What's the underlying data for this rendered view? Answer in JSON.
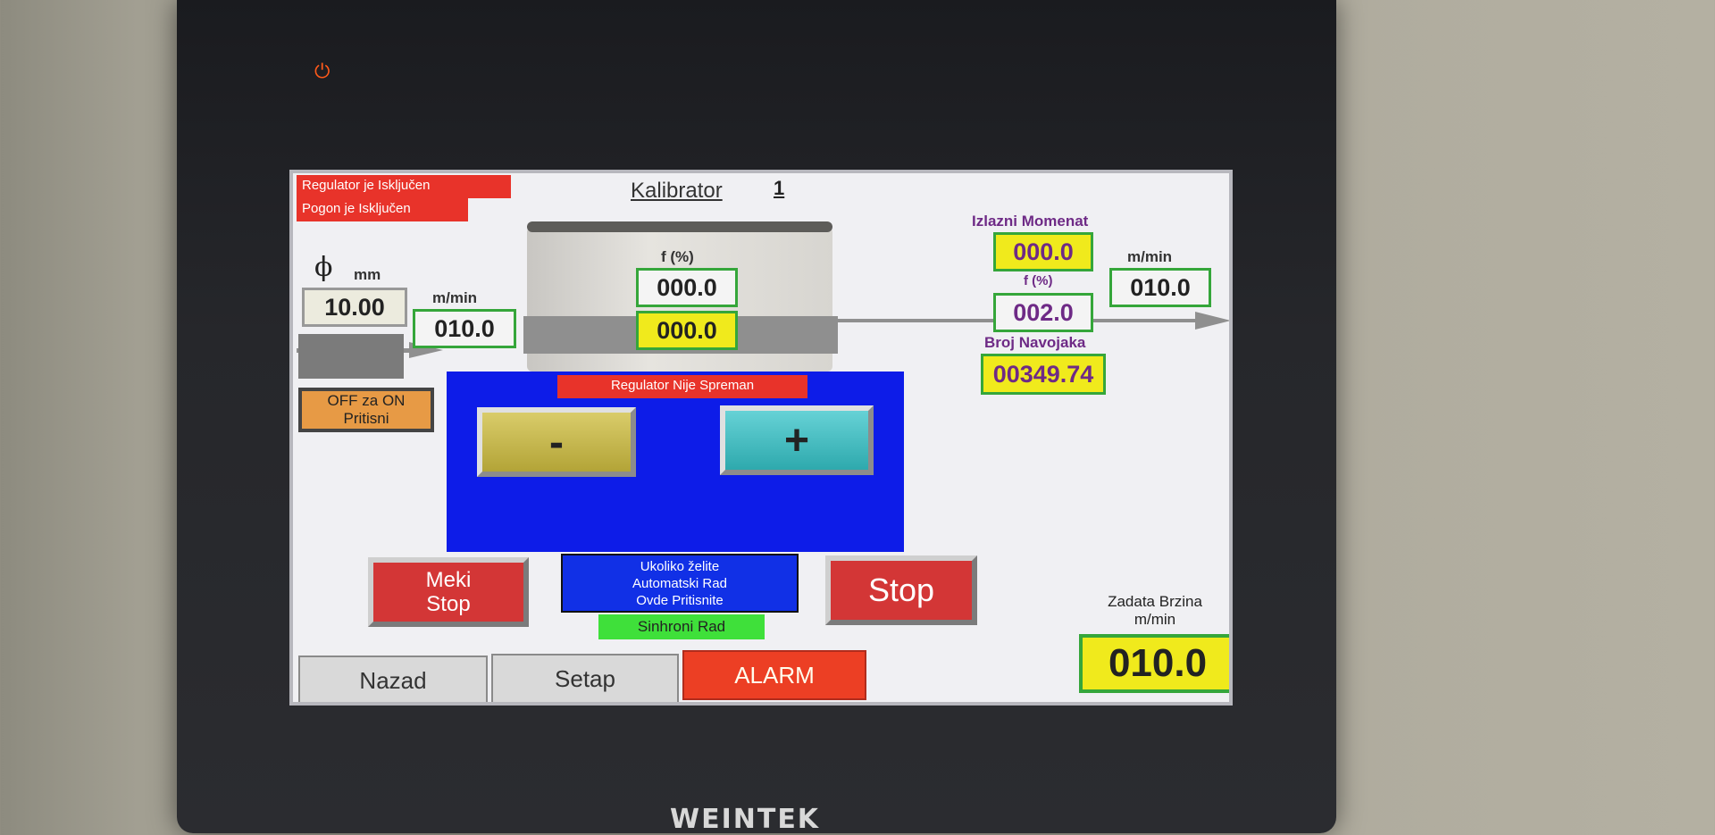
{
  "device": {
    "brand": "WEINTEK",
    "power_icon": "⏻"
  },
  "status": {
    "regulator": "Regulator je Isključen",
    "drive": "Pogon je Isključen"
  },
  "header": {
    "title": "Kalibrator",
    "number": "1"
  },
  "input_side": {
    "diameter_symbol": "ϕ",
    "diameter_unit": "mm",
    "diameter_value": "10.00",
    "speed_unit": "m/min",
    "speed_value": "010.0",
    "toggle_label_line1": "OFF za ON",
    "toggle_label_line2": "Pritisni"
  },
  "center": {
    "f_label": "f (%)",
    "f_value": "000.0",
    "f_value_yellow": "000.0",
    "regulator_status": "Regulator Nije Spreman",
    "minus_label": "-",
    "plus_label": "+"
  },
  "output_side": {
    "torque_label": "Izlazni Momenat",
    "torque_value": "000.0",
    "f_label": "f (%)",
    "f_value": "002.0",
    "speed_unit": "m/min",
    "speed_value": "010.0",
    "turns_label": "Broj Navojaka",
    "turns_value": "00349.74"
  },
  "controls": {
    "soft_stop_line1": "Meki",
    "soft_stop_line2": "Stop",
    "auto_line1": "Ukoliko želite",
    "auto_line2": "Automatski Rad",
    "auto_line3": "Ovde Pritisnite",
    "sync_mode": "Sinhroni Rad",
    "stop_label": "Stop"
  },
  "setpoint": {
    "label_line1": "Zadata Brzina",
    "label_line2": "m/min",
    "value": "010.0"
  },
  "tabs": {
    "back": "Nazad",
    "setup": "Setap",
    "alarm": "ALARM"
  },
  "colors": {
    "panel_blue": "#0d1ce8",
    "value_border_green": "#35a63a",
    "alarm_red": "#ec3f24",
    "value_yellow": "#f0ea1c"
  }
}
